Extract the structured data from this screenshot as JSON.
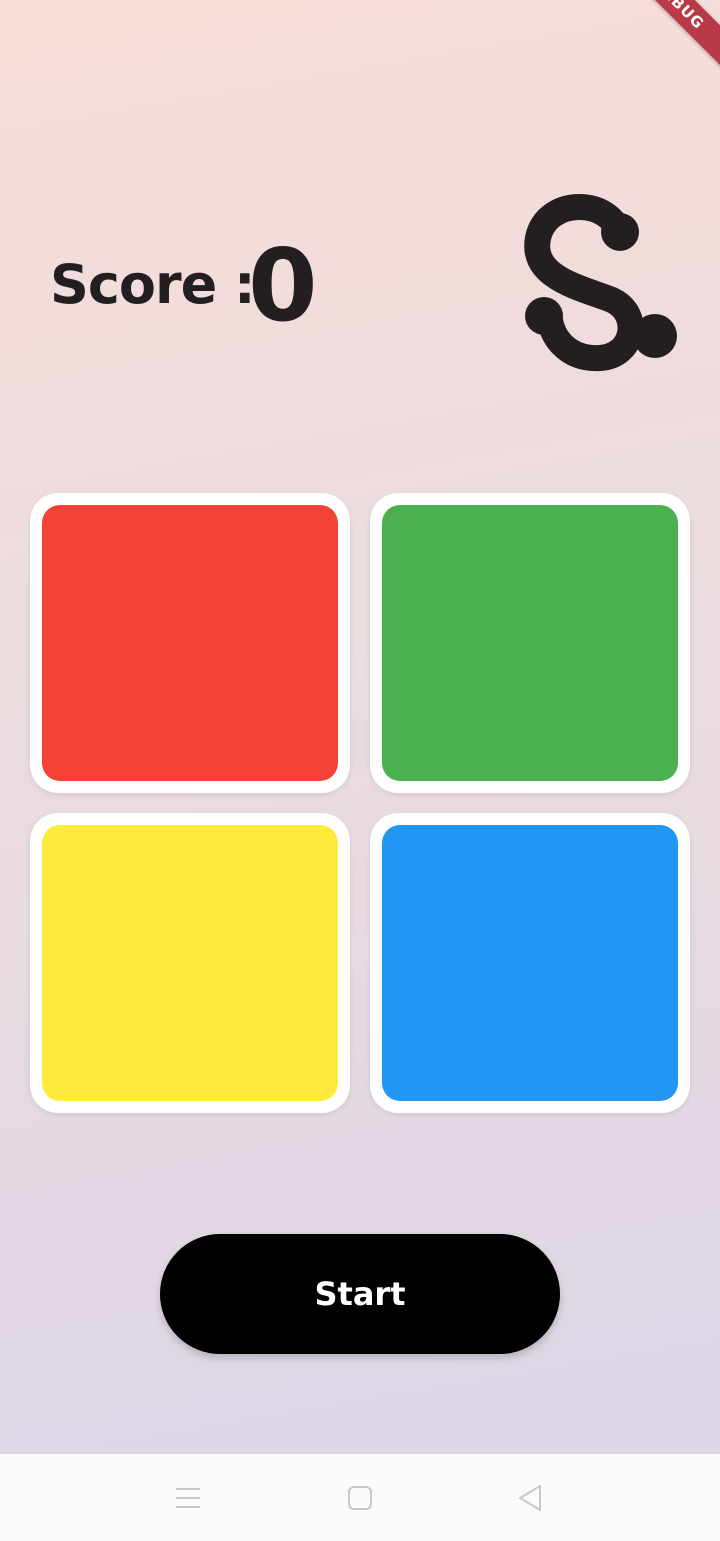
{
  "debug_banner": {
    "label": "DEBUG"
  },
  "score": {
    "label": "Score :",
    "value": "0"
  },
  "logo": {
    "icon": "s-logo-icon"
  },
  "tiles": [
    {
      "name": "red",
      "color": "#f44336"
    },
    {
      "name": "green",
      "color": "#4caf50"
    },
    {
      "name": "yellow",
      "color": "#ffeb3b"
    },
    {
      "name": "blue",
      "color": "#2196f3"
    }
  ],
  "start_button": {
    "label": "Start"
  },
  "navbar": {
    "menu_icon": "menu-icon",
    "home_icon": "home-square-icon",
    "back_icon": "back-triangle-icon"
  }
}
